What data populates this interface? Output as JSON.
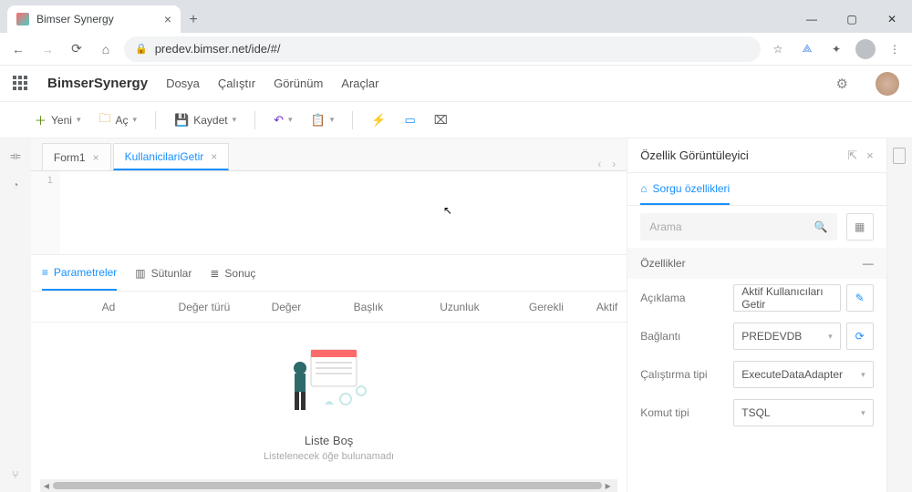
{
  "browser": {
    "tab_title": "Bimser Synergy",
    "url": "predev.bimser.net/ide/#/"
  },
  "app": {
    "name": "BimserSynergy",
    "menus": [
      "Dosya",
      "Çalıştır",
      "Görünüm",
      "Araçlar"
    ]
  },
  "toolbar": {
    "new": "Yeni",
    "open": "Aç",
    "save": "Kaydet"
  },
  "editor": {
    "tabs": [
      {
        "label": "Form1",
        "active": false
      },
      {
        "label": "KullanicilariGetir",
        "active": true
      }
    ],
    "line_number": "1"
  },
  "sub_tabs": [
    {
      "label": "Parametreler",
      "active": true
    },
    {
      "label": "Sütunlar",
      "active": false
    },
    {
      "label": "Sonuç",
      "active": false
    }
  ],
  "grid": {
    "columns": [
      "Ad",
      "Değer türü",
      "Değer",
      "Başlık",
      "Uzunluk",
      "Gerekli",
      "Aktif"
    ],
    "empty_title": "Liste Boş",
    "empty_subtitle": "Listelenecek öğe bulunamadı"
  },
  "properties_panel": {
    "title": "Özellik Görüntüleyici",
    "tab_label": "Sorgu özellikleri",
    "search_placeholder": "Arama",
    "section_title": "Özellikler",
    "fields": {
      "aciklama": {
        "label": "Açıklama",
        "value": "Aktif Kullanıcıları Getir"
      },
      "baglanti": {
        "label": "Bağlantı",
        "value": "PREDEVDB"
      },
      "calistirma_tipi": {
        "label": "Çalıştırma tipi",
        "value": "ExecuteDataAdapter"
      },
      "komut_tipi": {
        "label": "Komut tipi",
        "value": "TSQL"
      }
    }
  }
}
